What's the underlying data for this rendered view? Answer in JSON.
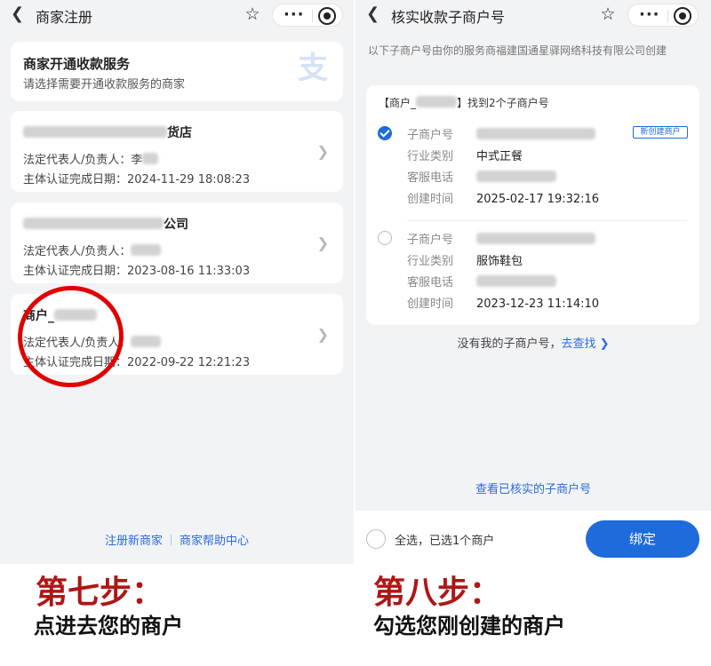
{
  "left": {
    "nav_title": "商家注册",
    "service_card": {
      "title": "商家开通收款服务",
      "subtitle": "请选择需要开通收款服务的商家",
      "logo_char": "支"
    },
    "merchants": [
      {
        "name_suffix": "货店",
        "rep_label": "法定代表人/负责人：",
        "rep_value": "李",
        "date_label": "主体认证完成日期：",
        "date_value": "2024-11-29 18:08:23"
      },
      {
        "name_suffix": "公司",
        "rep_label": "法定代表人/负责人：",
        "rep_value": "",
        "date_label": "主体认证完成日期：",
        "date_value": "2023-08-16 11:33:03"
      },
      {
        "name_prefix": "商户_",
        "rep_label": "法定代表人/负责人：",
        "rep_value": "",
        "date_label": "主体认证完成日期：",
        "date_value": "2022-09-22 12:21:23"
      }
    ],
    "links": {
      "register": "注册新商家",
      "help": "商家帮助中心"
    }
  },
  "right": {
    "nav_title": "核实收款子商户号",
    "intro": "以下子商户号由你的服务商福建国通星驿网络科技有限公司创建",
    "found": {
      "head_prefix": "【商户_",
      "head_suffix": "】找到2个子商户号"
    },
    "labels": {
      "sub_no": "子商户号",
      "industry": "行业类别",
      "phone": "客服电话",
      "created": "创建时间"
    },
    "subs": [
      {
        "industry": "中式正餐",
        "created": "2025-02-17 19:32:16",
        "badge": "新创建商户",
        "checked": true
      },
      {
        "industry": "服饰鞋包",
        "created": "2023-12-23 11:14:10",
        "checked": false
      }
    ],
    "no_sub_text": "没有我的子商户号，",
    "find_link": "去查找",
    "verified_link": "查看已核实的子商户号",
    "select_all_text": "全选，已选1个商户",
    "bind_button": "绑定"
  },
  "captions": {
    "step7": "第七步：",
    "step7_desc": "点进去您的商户",
    "step8": "第八步：",
    "step8_desc": "勾选您刚创建的商户"
  },
  "colors": {
    "accent": "#1e6bdb",
    "highlight_circle": "#e00000",
    "caption_step": "#b01515"
  }
}
